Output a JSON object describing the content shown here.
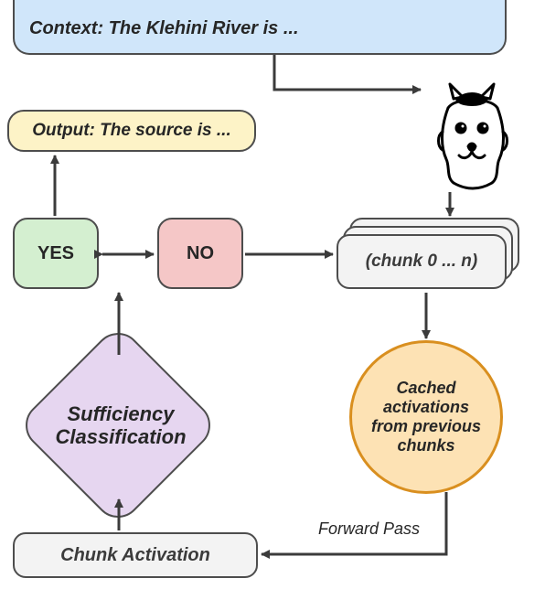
{
  "context_box": {
    "label": "Context:",
    "text": " The Klehini River is ..."
  },
  "output_box": {
    "label": "Output:",
    "text": " The source is ..."
  },
  "yes_box": {
    "label": "YES"
  },
  "no_box": {
    "label": "NO"
  },
  "chunk_stack": {
    "label": "(chunk 0 ... n)"
  },
  "diamond": {
    "line1": "Sufficiency",
    "line2": "Classification"
  },
  "circle": {
    "line1": "Cached",
    "line2": "activations",
    "line3": "from previous",
    "line4": "chunks"
  },
  "chunk_activation": {
    "label": "Chunk Activation"
  },
  "forward_pass": {
    "label": "Forward Pass"
  },
  "llama": {
    "name": "llama-icon"
  }
}
